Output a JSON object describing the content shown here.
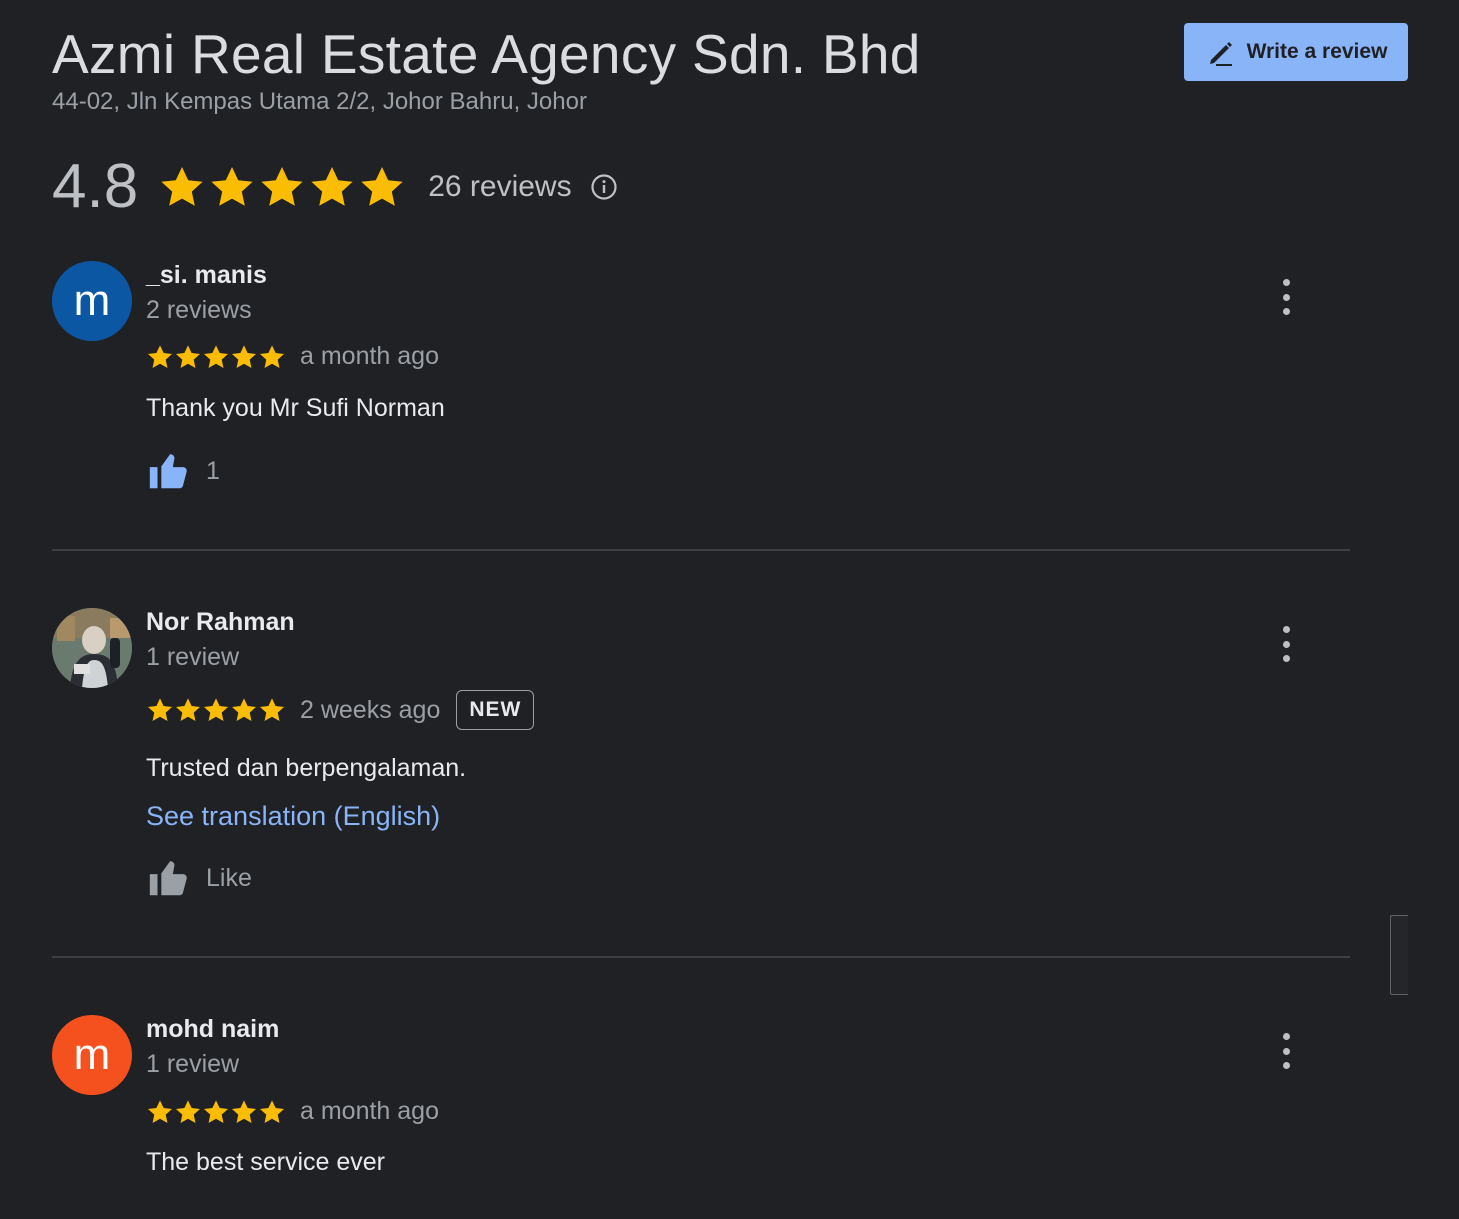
{
  "business": {
    "title": "Azmi Real Estate Agency Sdn. Bhd",
    "address": "44-02, Jln Kempas Utama 2/2, Johor Bahru, Johor"
  },
  "write_review": {
    "label": "Write a review",
    "icon": "pencil-icon"
  },
  "summary": {
    "rating": "4.8",
    "stars": 5,
    "reviews_text": "26 reviews",
    "star_color": "#fbbc04"
  },
  "reviews": [
    {
      "author": "_si. manis",
      "avatar_letter": "m",
      "avatar_color": "#0b57a3",
      "meta": "2 reviews",
      "stars": 5,
      "time": "a month ago",
      "text": "Thank you Mr Sufi Norman",
      "like_label": "1",
      "liked": true
    },
    {
      "author": "Nor Rahman",
      "avatar_letter": "",
      "avatar_color": "#4a5a52",
      "meta": "1 review",
      "stars": 5,
      "time": "2 weeks ago",
      "badge": "NEW",
      "text": "Trusted dan berpengalaman.",
      "translate": "See translation (English)",
      "like_label": "Like",
      "liked": false
    },
    {
      "author": "mohd naim",
      "avatar_letter": "m",
      "avatar_color": "#f4511e",
      "meta": "1 review",
      "stars": 5,
      "time": "a month ago",
      "text": "The best service ever"
    }
  ],
  "colors": {
    "background": "#202124",
    "accent": "#8ab4f8",
    "star": "#fbbc04"
  }
}
